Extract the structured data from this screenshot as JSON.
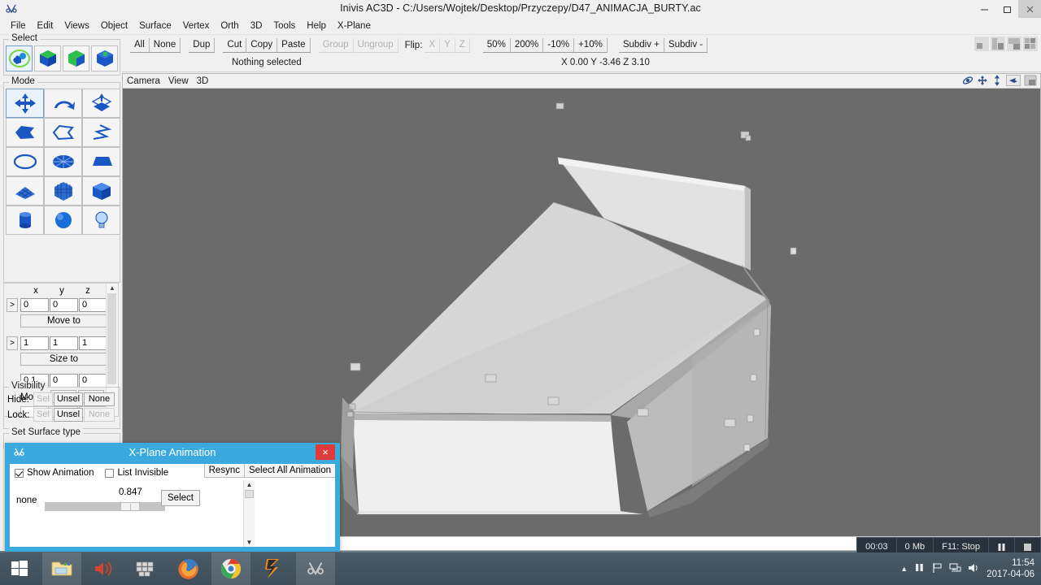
{
  "window": {
    "title": "Inivis AC3D - C:/Users/Wojtek/Desktop/Przyczepy/D47_ANIMACJA_BURTY.ac",
    "app_icon": "ac3d-icon",
    "minimize_label": "–",
    "maximize_label": "❐",
    "close_label": "×"
  },
  "menubar": {
    "items": [
      {
        "label": "File"
      },
      {
        "label": "Edit"
      },
      {
        "label": "Views"
      },
      {
        "label": "Object"
      },
      {
        "label": "Surface"
      },
      {
        "label": "Vertex"
      },
      {
        "label": "Orth"
      },
      {
        "label": "3D"
      },
      {
        "label": "Tools"
      },
      {
        "label": "Help"
      },
      {
        "label": "X-Plane"
      }
    ]
  },
  "toolbar": {
    "buttons": [
      {
        "label": "All",
        "disabled": false,
        "gap_before": false
      },
      {
        "label": "None",
        "disabled": false,
        "gap_before": false
      },
      {
        "label": "Dup",
        "disabled": false,
        "gap_before": true
      },
      {
        "label": "Cut",
        "disabled": false,
        "gap_before": true
      },
      {
        "label": "Copy",
        "disabled": false,
        "gap_before": false
      },
      {
        "label": "Paste",
        "disabled": false,
        "gap_before": false
      },
      {
        "label": "Group",
        "disabled": true,
        "gap_before": true
      },
      {
        "label": "Ungroup",
        "disabled": true,
        "gap_before": false
      }
    ],
    "flip_label": "Flip:",
    "flip_axes": [
      {
        "label": "X",
        "disabled": true
      },
      {
        "label": "Y",
        "disabled": true
      },
      {
        "label": "Z",
        "disabled": true
      }
    ],
    "scale_buttons": [
      {
        "label": "50%"
      },
      {
        "label": "200%"
      },
      {
        "label": "-10%"
      },
      {
        "label": "+10%"
      }
    ],
    "subdiv_buttons": [
      {
        "label": "Subdiv +"
      },
      {
        "label": "Subdiv -"
      }
    ],
    "layout_buttons": [
      {
        "name": "layout-single"
      },
      {
        "name": "layout-two"
      },
      {
        "name": "layout-three"
      },
      {
        "name": "layout-four"
      }
    ]
  },
  "status": {
    "selection_text": "Nothing selected",
    "coordinates": "X 0.00 Y -3.46 Z 3.10"
  },
  "select_panel": {
    "title": "Select",
    "buttons": [
      {
        "name": "select-group",
        "selected": true
      },
      {
        "name": "select-object",
        "selected": false
      },
      {
        "name": "select-surface",
        "selected": false
      },
      {
        "name": "select-vertex",
        "selected": false
      }
    ]
  },
  "mode_panel": {
    "title": "Mode",
    "buttons": [
      {
        "name": "move-tool",
        "selected": true
      },
      {
        "name": "rotate-tool",
        "selected": false
      },
      {
        "name": "extrude-tool",
        "selected": false
      },
      {
        "name": "polygon-tool",
        "selected": false
      },
      {
        "name": "outline-tool",
        "selected": false
      },
      {
        "name": "polyline-tool",
        "selected": false
      },
      {
        "name": "disc-tool",
        "selected": false
      },
      {
        "name": "cylinder-fan-tool",
        "selected": false
      },
      {
        "name": "plane-tool",
        "selected": false
      },
      {
        "name": "grid-tool",
        "selected": false
      },
      {
        "name": "mesh-cube-tool",
        "selected": false
      },
      {
        "name": "box-tool",
        "selected": false
      },
      {
        "name": "cylinder-tool",
        "selected": false
      },
      {
        "name": "sphere-tool",
        "selected": false
      },
      {
        "name": "light-tool",
        "selected": false
      }
    ]
  },
  "transform_panel": {
    "axis_headers": [
      "x",
      "y",
      "z"
    ],
    "expand_label": ">",
    "move_values": [
      "0",
      "0",
      "0"
    ],
    "move_to_label": "Move to",
    "size_values": [
      "1",
      "1",
      "1"
    ],
    "size_to_label": "Size to",
    "step_values": [
      "0.1",
      "0",
      "0"
    ],
    "move_label": "Move",
    "plus_label": "+",
    "minus_label": "-"
  },
  "visibility_panel": {
    "title": "Visibility",
    "hide_label": "Hide:",
    "lock_label": "Lock:",
    "hide_buttons": [
      {
        "label": "Sel",
        "disabled": true
      },
      {
        "label": "Unsel",
        "disabled": false
      },
      {
        "label": "None",
        "disabled": false
      }
    ],
    "lock_buttons": [
      {
        "label": "Sel",
        "disabled": true
      },
      {
        "label": "Unsel",
        "disabled": false
      },
      {
        "label": "None",
        "disabled": true
      }
    ],
    "surface_type_label": "Set Surface type"
  },
  "viewport": {
    "header_items": [
      "Camera",
      "View",
      "3D"
    ],
    "icons": [
      "orbit-icon",
      "pan-icon",
      "zoom-icon",
      "pointer-icon",
      "render-icon"
    ],
    "background_color": "#6b6b6b"
  },
  "animation_dialog": {
    "title": "X-Plane Animation",
    "icon": "ac3d-icon",
    "close_label": "×",
    "show_animation_label": "Show Animation",
    "show_animation_checked": true,
    "list_invisible_label": "List Invisible",
    "list_invisible_checked": false,
    "resync_label": "Resync",
    "select_all_label": "Select All Animation",
    "dataref_label": "none",
    "slider_value": "0.847",
    "select_label": "Select",
    "scroll_up": "▲",
    "scroll_down": "▼",
    "accent_color": "#3aa9dd",
    "close_color": "#e03b3b"
  },
  "recorder_bar": {
    "elapsed": "00:03",
    "size": "0 Mb",
    "hotkey": "F11: Stop",
    "pause_label": "pause-icon",
    "stop_label": "stop-icon"
  },
  "taskbar": {
    "start_label": "start-button",
    "items": [
      {
        "name": "file-explorer-icon",
        "active": true
      },
      {
        "name": "volume-icon",
        "active": false
      },
      {
        "name": "app-tiles-icon",
        "active": false
      },
      {
        "name": "firefox-icon",
        "active": false
      },
      {
        "name": "chrome-icon",
        "active": true
      },
      {
        "name": "fl-studio-icon",
        "active": false
      },
      {
        "name": "ac3d-icon",
        "active": true
      }
    ],
    "tray": {
      "show_hidden": "▲",
      "icons": [
        "pause-icon",
        "flag-icon",
        "network-icon",
        "speaker-icon"
      ],
      "time": "11:54",
      "date": "2017-04-06"
    }
  }
}
